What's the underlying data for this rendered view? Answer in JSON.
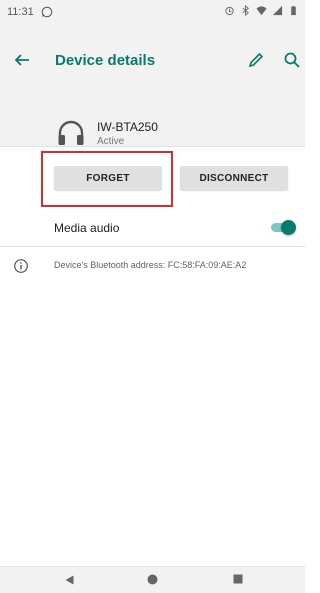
{
  "status_bar": {
    "time": "11:31"
  },
  "app_bar": {
    "title": "Device details"
  },
  "device": {
    "name": "IW-BTA250",
    "status": "Active"
  },
  "actions": {
    "forget_label": "FORGET",
    "disconnect_label": "DISCONNECT"
  },
  "settings": {
    "media_audio_label": "Media audio",
    "media_audio_enabled": true
  },
  "info": {
    "address_text": "Device's Bluetooth address: FC:58:FA:09:AE:A2"
  },
  "colors": {
    "accent": "#0b7a6e",
    "highlight": "#d32f2f",
    "background": "#f2f2f2"
  },
  "icons": [
    "whatsapp-icon",
    "alarm-icon",
    "bluetooth-icon",
    "wifi-icon",
    "signal-icon",
    "battery-icon",
    "back-arrow-icon",
    "edit-icon",
    "search-icon",
    "headphones-icon",
    "info-icon",
    "nav-back-icon",
    "nav-home-icon",
    "nav-recents-icon"
  ]
}
